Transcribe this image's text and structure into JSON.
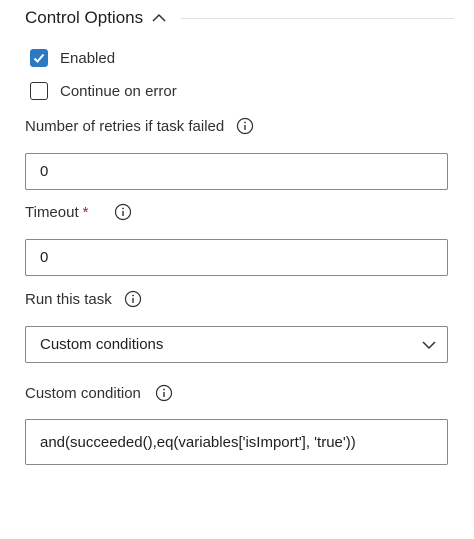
{
  "section": {
    "title": "Control Options"
  },
  "enabled": {
    "label": "Enabled",
    "checked": true
  },
  "continue_on_error": {
    "label": "Continue on error",
    "checked": false
  },
  "retries": {
    "label": "Number of retries if task failed",
    "value": "0"
  },
  "timeout": {
    "label": "Timeout",
    "required_mark": "*",
    "value": "0"
  },
  "run_this_task": {
    "label": "Run this task",
    "selected": "Custom conditions"
  },
  "custom_condition": {
    "label": "Custom condition",
    "value": "and(succeeded(),eq(variables['isImport'], 'true'))"
  },
  "icons": {
    "collapse": "chevron-up-icon",
    "info": "info-icon",
    "dropdown": "chevron-down-icon",
    "check": "check-icon"
  },
  "colors": {
    "accent": "#2b78c5",
    "required": "#a4262c",
    "border": "#8a8886"
  }
}
